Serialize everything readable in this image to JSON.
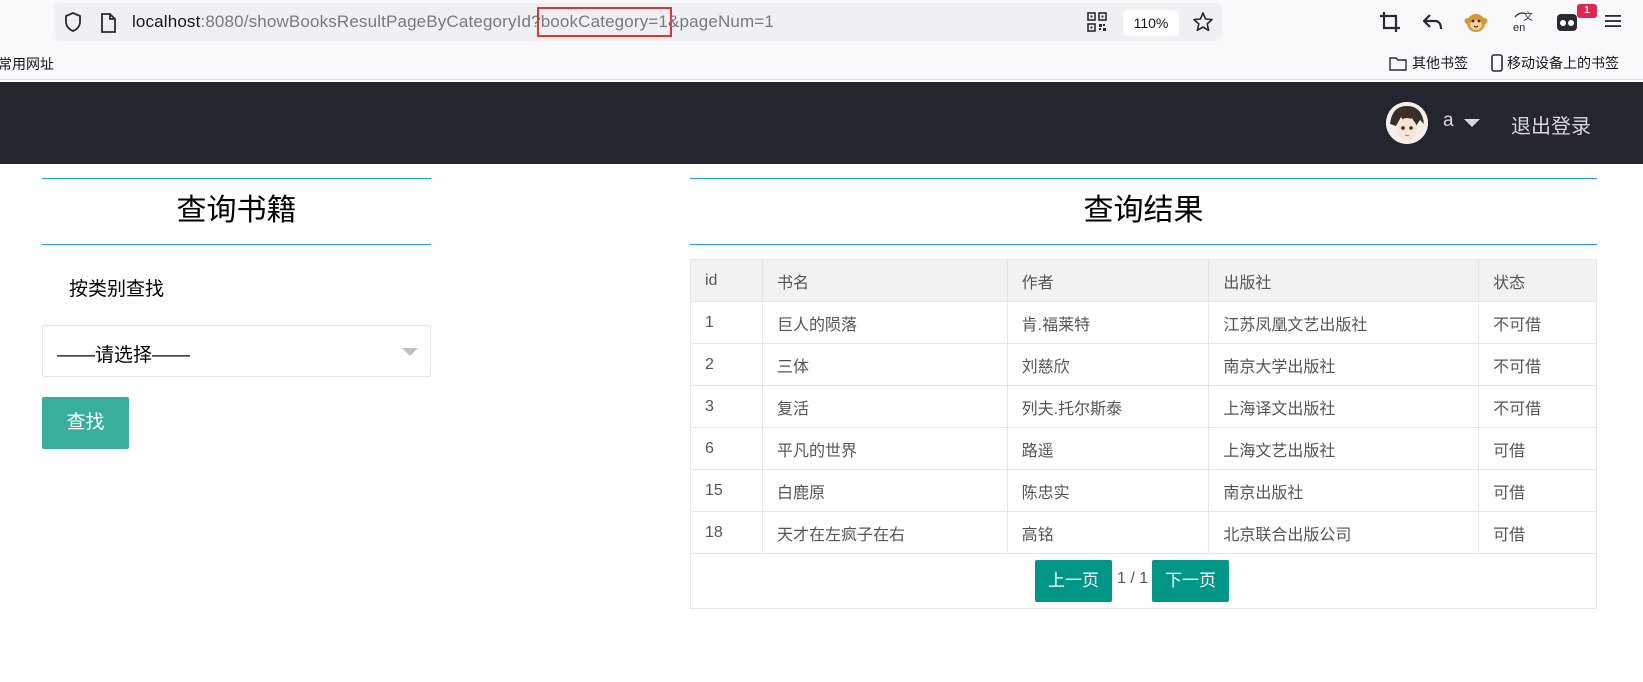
{
  "browser": {
    "url_host": "localhost",
    "url_mid": ":8080/showBooksResultPageByCategoryId?",
    "url_highlight": "bookCategory=1",
    "url_tail": "&pageNum=1",
    "zoom": "110%",
    "extension_badge": "1",
    "bookmarks": {
      "left": "常用网址",
      "other": "其他书签",
      "mobile": "移动设备上的书签"
    }
  },
  "header": {
    "user": "a",
    "logout": "退出登录"
  },
  "search_panel": {
    "title": "查询书籍",
    "category_label": "按类别查找",
    "select_placeholder": "——请选择——",
    "search_button": "查找"
  },
  "results": {
    "title": "查询结果",
    "columns": [
      "id",
      "书名",
      "作者",
      "出版社",
      "状态"
    ],
    "rows": [
      [
        "1",
        "巨人的陨落",
        "肯.福莱特",
        "江苏凤凰文艺出版社",
        "不可借"
      ],
      [
        "2",
        "三体",
        "刘慈欣",
        "南京大学出版社",
        "不可借"
      ],
      [
        "3",
        "复活",
        "列夫.托尔斯泰",
        "上海译文出版社",
        "不可借"
      ],
      [
        "6",
        "平凡的世界",
        "路遥",
        "上海文艺出版社",
        "可借"
      ],
      [
        "15",
        "白鹿原",
        "陈忠实",
        "南京出版社",
        "可借"
      ],
      [
        "18",
        "天才在左疯子在右",
        "高铭",
        "北京联合出版公司",
        "可借"
      ]
    ],
    "pager": {
      "prev": "上一页",
      "info": "1 / 1",
      "next": "下一页"
    }
  },
  "colors": {
    "header_bg": "#23262e",
    "accent_line": "#1e9fff",
    "search_button": "#38ae9c",
    "pager_button": "#009688"
  }
}
